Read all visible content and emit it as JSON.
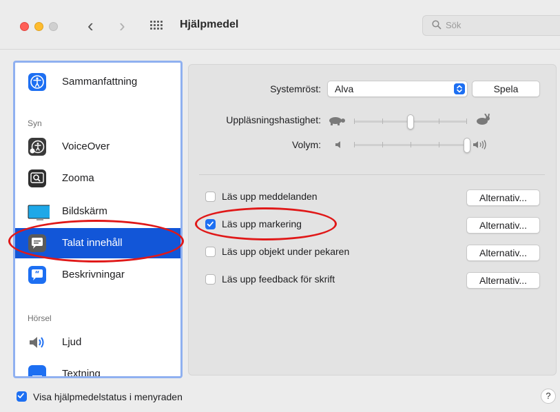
{
  "window": {
    "title": "Hjälpmedel"
  },
  "search": {
    "placeholder": "Sök"
  },
  "sidebar": {
    "items": [
      {
        "label": "Sammanfattning",
        "icon": "accessibility-icon"
      },
      {
        "label": "VoiceOver",
        "icon": "voiceover-icon"
      },
      {
        "label": "Zooma",
        "icon": "zoom-icon"
      },
      {
        "label": "Bildskärm",
        "icon": "display-icon"
      },
      {
        "label": "Talat innehåll",
        "icon": "speech-bubble-icon",
        "selected": true
      },
      {
        "label": "Beskrivningar",
        "icon": "quote-bubble-icon"
      },
      {
        "label": "Ljud",
        "icon": "speaker-icon"
      },
      {
        "label": "Textning",
        "icon": "captions-icon"
      }
    ],
    "section_syn": "Syn",
    "section_horsel": "Hörsel"
  },
  "main": {
    "system_voice_label": "Systemröst:",
    "system_voice_value": "Alva",
    "play_label": "Spela",
    "rate_label": "Uppläsningshastighet:",
    "rate_value": 0.5,
    "volume_label": "Volym:",
    "volume_value": 1.0,
    "options": [
      {
        "label": "Läs upp meddelanden",
        "checked": false,
        "button": "Alternativ..."
      },
      {
        "label": "Läs upp markering",
        "checked": true,
        "button": "Alternativ..."
      },
      {
        "label": "Läs upp objekt under pekaren",
        "checked": false,
        "button": "Alternativ..."
      },
      {
        "label": "Läs upp feedback för skrift",
        "checked": false,
        "button": "Alternativ..."
      }
    ]
  },
  "footer": {
    "menubar_status_label": "Visa hjälpmedelstatus i menyraden",
    "menubar_status_checked": true,
    "help_label": "?"
  },
  "colors": {
    "accent": "#1d6ff2",
    "selection": "#1256d8",
    "annotation": "#e01818"
  }
}
